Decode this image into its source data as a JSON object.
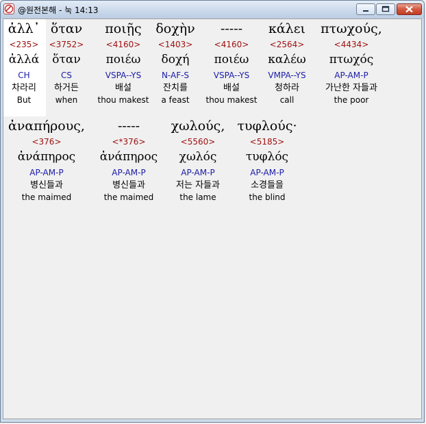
{
  "window": {
    "title": "@원전본해 - 눅 14:13"
  },
  "row1": [
    {
      "greek": "ἀλλ᾽",
      "strong": "<235>",
      "lemma": "ἀλλά",
      "parsing": "CH",
      "korean": "차라리",
      "english": "But"
    },
    {
      "greek": "ὅταν",
      "strong": "<3752>",
      "lemma": "ὅταν",
      "parsing": "CS",
      "korean": "하거든",
      "english": "when"
    },
    {
      "greek": "ποιῇς",
      "strong": "<4160>",
      "lemma": "ποιέω",
      "parsing": "VSPA--YS",
      "korean": "배설",
      "english": "thou makest"
    },
    {
      "greek": "δοχὴν",
      "strong": "<1403>",
      "lemma": "δοχή",
      "parsing": "N-AF-S",
      "korean": "잔치를",
      "english": "a feast"
    },
    {
      "greek": "-----",
      "strong": "<4160>",
      "lemma": "ποιέω",
      "parsing": "VSPA--YS",
      "korean": "배설",
      "english": "thou makest"
    },
    {
      "greek": "κάλει",
      "strong": "<2564>",
      "lemma": "καλέω",
      "parsing": "VMPA--YS",
      "korean": "청하라",
      "english": "call"
    },
    {
      "greek": "πτωχούς,",
      "strong": "<4434>",
      "lemma": "πτωχός",
      "parsing": "AP-AM-P",
      "korean": "가난한 자들과",
      "english": "the poor"
    }
  ],
  "row2": [
    {
      "greek": "ἀναπήρους,",
      "strong": "<376>",
      "lemma": "ἀνάπηρος",
      "parsing": "AP-AM-P",
      "korean": "병신들과",
      "english": "the maimed"
    },
    {
      "greek": "-----",
      "strong": "<*376>",
      "lemma": "ἀνάπηρος",
      "parsing": "AP-AM-P",
      "korean": "병신들과",
      "english": "the maimed"
    },
    {
      "greek": "χωλούς,",
      "strong": "<5560>",
      "lemma": "χωλός",
      "parsing": "AP-AM-P",
      "korean": "저는 자들과",
      "english": "the lame"
    },
    {
      "greek": "τυφλούς·",
      "strong": "<5185>",
      "lemma": "τυφλός",
      "parsing": "AP-AM-P",
      "korean": "소경들을",
      "english": "the blind"
    }
  ]
}
